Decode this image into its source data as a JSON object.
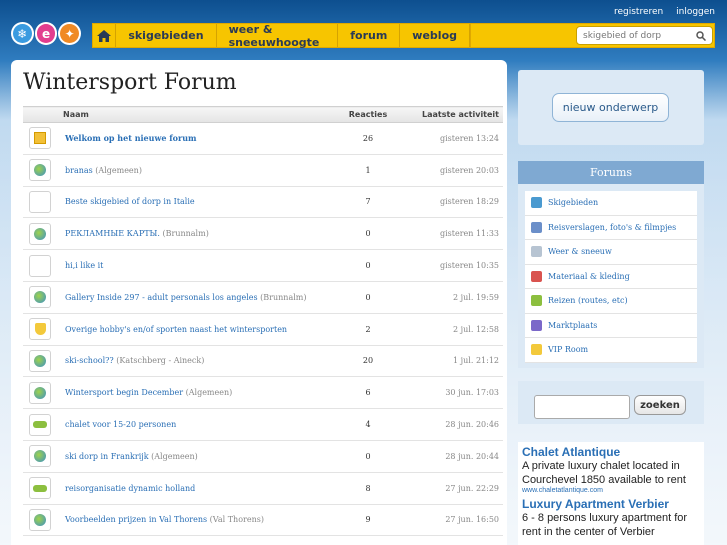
{
  "top_links": {
    "register": "registreren",
    "login": "inloggen"
  },
  "nav": {
    "items": [
      "skigebieden",
      "weer & sneeuwhoogte",
      "forum",
      "weblog"
    ],
    "search_placeholder": "skigebied of dorp"
  },
  "page": {
    "title": "Wintersport Forum"
  },
  "table": {
    "headers": {
      "name": "Naam",
      "replies": "Reacties",
      "activity": "Laatste activiteit"
    },
    "rows": [
      {
        "icon": "sticky",
        "title": "Welkom op het nieuwe forum",
        "category": "",
        "replies": "26",
        "activity": "gisteren 13:24",
        "bold": true
      },
      {
        "icon": "globe",
        "title": "branas",
        "category": "(Algemeen)",
        "replies": "1",
        "activity": "gisteren 20:03"
      },
      {
        "icon": "none",
        "title": "Beste skigebied of dorp in Italie",
        "category": "",
        "replies": "7",
        "activity": "gisteren 18:29"
      },
      {
        "icon": "globe",
        "title": "РЕКЛАМНЫЕ КАРТЫ.",
        "category": "(Brunnalm)",
        "replies": "0",
        "activity": "gisteren 11:33"
      },
      {
        "icon": "none",
        "title": "hi,i like it",
        "category": "",
        "replies": "0",
        "activity": "gisteren 10:35"
      },
      {
        "icon": "globe",
        "title": "Gallery Inside 297 - adult personals los angeles",
        "category": "(Brunnalm)",
        "replies": "0",
        "activity": "2 jul. 19:59"
      },
      {
        "icon": "shield",
        "title": "Overige hobby's en/of sporten naast het wintersporten",
        "category": "",
        "replies": "2",
        "activity": "2 jul. 12:58"
      },
      {
        "icon": "globe",
        "title": "ski-school??",
        "category": "(Katschberg - Aineck)",
        "replies": "20",
        "activity": "1 jul. 21:12"
      },
      {
        "icon": "globe",
        "title": "Wintersport begin December",
        "category": "(Algemeen)",
        "replies": "6",
        "activity": "30 jun. 17:03"
      },
      {
        "icon": "car",
        "title": "chalet voor 15-20 personen",
        "category": "",
        "replies": "4",
        "activity": "28 jun. 20:46"
      },
      {
        "icon": "globe",
        "title": "ski dorp in Frankrijk",
        "category": "(Algemeen)",
        "replies": "0",
        "activity": "28 jun. 20:44"
      },
      {
        "icon": "car",
        "title": "reisorganisatie dynamic holland",
        "category": "",
        "replies": "8",
        "activity": "27 jun. 22:29"
      },
      {
        "icon": "globe",
        "title": "Voorbeelden prijzen in Val Thorens",
        "category": "(Val Thorens)",
        "replies": "9",
        "activity": "27 jun. 16:50"
      }
    ]
  },
  "sidebar": {
    "new_topic": "nieuw onderwerp",
    "forums_title": "Forums",
    "forums": [
      {
        "label": "Skigebieden",
        "icon": "globe-icon",
        "color": "#4a9ad0"
      },
      {
        "label": "Reisverslagen, foto's & filmpjes",
        "icon": "photo-icon",
        "color": "#6b8fc9"
      },
      {
        "label": "Weer & sneeuw",
        "icon": "cloud-icon",
        "color": "#b7c4d2"
      },
      {
        "label": "Materiaal & kleding",
        "icon": "ski-icon",
        "color": "#d9534f"
      },
      {
        "label": "Reizen (routes, etc)",
        "icon": "car-icon",
        "color": "#8cbf3f"
      },
      {
        "label": "Marktplaats",
        "icon": "market-icon",
        "color": "#7b68c9"
      },
      {
        "label": "VIP Room",
        "icon": "shield-icon",
        "color": "#f3c93b"
      }
    ],
    "search_button": "zoeken"
  },
  "ads": [
    {
      "title": "Chalet Atlantique",
      "body": "A private luxury chalet located in Courchevel 1850 available to rent",
      "url": "www.chaletatlantique.com"
    },
    {
      "title": "Luxury Apartment Verbier",
      "body": "6 - 8 persons luxury apartment for rent in the center of Verbier",
      "url": ""
    }
  ]
}
